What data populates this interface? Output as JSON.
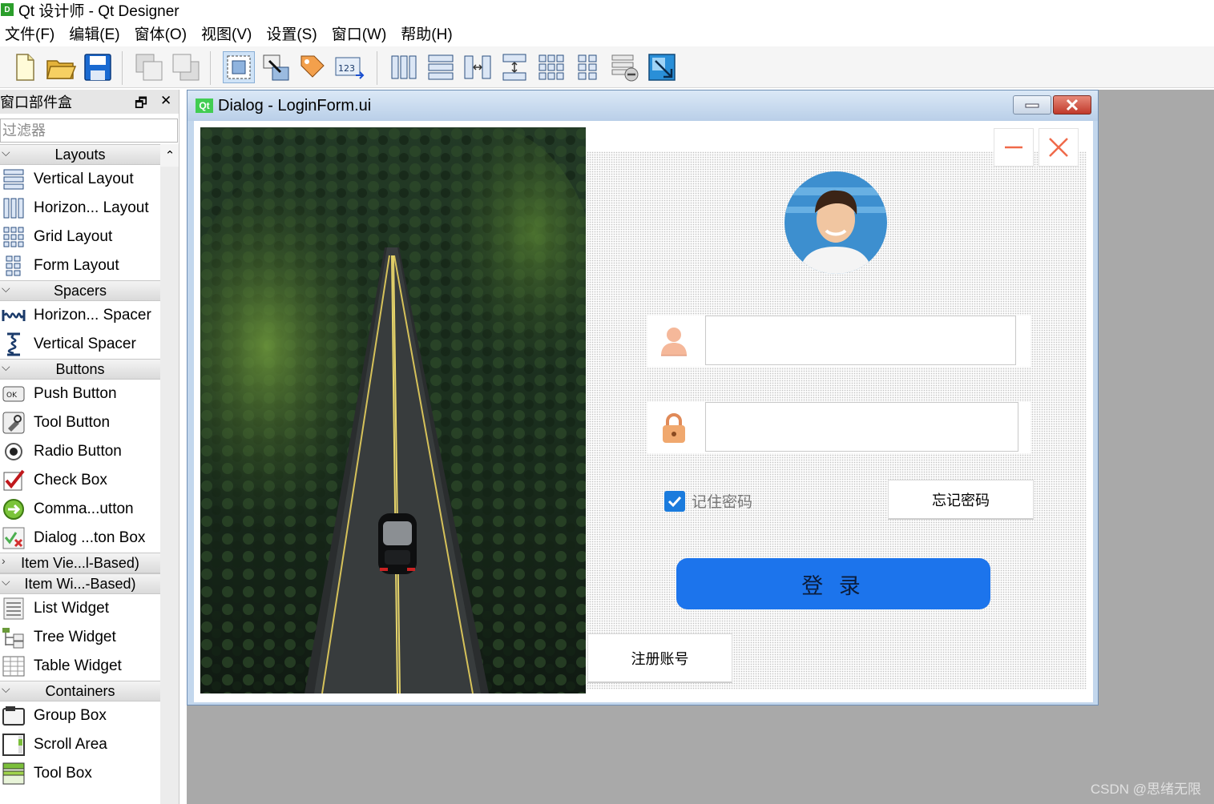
{
  "app": {
    "title": "Qt 设计师 - Qt Designer",
    "icon_letter": "D"
  },
  "menu": [
    "文件(F)",
    "编辑(E)",
    "窗体(O)",
    "视图(V)",
    "设置(S)",
    "窗口(W)",
    "帮助(H)"
  ],
  "toolbar": {
    "icons": [
      "new-file-icon",
      "open-folder-icon",
      "save-icon",
      "send-to-back-icon",
      "bring-to-front-icon",
      "edit-widgets-icon",
      "edit-signals-slots-icon",
      "edit-buddies-icon",
      "edit-tab-order-icon",
      "layout-horizontal-icon",
      "layout-vertical-icon",
      "layout-horizontal-splitter-icon",
      "layout-vertical-splitter-icon",
      "layout-grid-icon",
      "layout-form-icon",
      "break-layout-icon",
      "adjust-size-icon"
    ]
  },
  "widget_box": {
    "title": "窗口部件盒",
    "filter_placeholder": "过滤器",
    "groups": [
      {
        "name": "Layouts",
        "expanded": true,
        "items": [
          {
            "label": "Vertical Layout",
            "icon": "vertical-layout-icon"
          },
          {
            "label": "Horizon... Layout",
            "icon": "horizontal-layout-icon"
          },
          {
            "label": "Grid Layout",
            "icon": "grid-layout-icon"
          },
          {
            "label": "Form Layout",
            "icon": "form-layout-icon"
          }
        ]
      },
      {
        "name": "Spacers",
        "expanded": true,
        "items": [
          {
            "label": "Horizon... Spacer",
            "icon": "horizontal-spacer-icon"
          },
          {
            "label": "Vertical Spacer",
            "icon": "vertical-spacer-icon"
          }
        ]
      },
      {
        "name": "Buttons",
        "expanded": true,
        "items": [
          {
            "label": "Push Button",
            "icon": "push-button-icon"
          },
          {
            "label": "Tool Button",
            "icon": "tool-button-icon"
          },
          {
            "label": "Radio Button",
            "icon": "radio-button-icon"
          },
          {
            "label": "Check Box",
            "icon": "check-box-icon"
          },
          {
            "label": "Comma...utton",
            "icon": "command-link-button-icon"
          },
          {
            "label": "Dialog ...ton Box",
            "icon": "dialog-button-box-icon"
          }
        ]
      },
      {
        "name": "Item Vie...l-Based)",
        "expanded": false,
        "items": []
      },
      {
        "name": "Item Wi...-Based)",
        "expanded": true,
        "items": [
          {
            "label": "List Widget",
            "icon": "list-widget-icon"
          },
          {
            "label": "Tree Widget",
            "icon": "tree-widget-icon"
          },
          {
            "label": "Table Widget",
            "icon": "table-widget-icon"
          }
        ]
      },
      {
        "name": "Containers",
        "expanded": true,
        "items": [
          {
            "label": "Group Box",
            "icon": "group-box-icon"
          },
          {
            "label": "Scroll Area",
            "icon": "scroll-area-icon"
          },
          {
            "label": "Tool Box",
            "icon": "tool-box-icon"
          }
        ]
      }
    ]
  },
  "form_window": {
    "badge": "Qt",
    "title": "Dialog - LoginForm.ui"
  },
  "login_form": {
    "username_value": "",
    "password_value": "",
    "remember_label": "记住密码",
    "remember_checked": true,
    "forget_label": "忘记密码",
    "login_label": "登 录",
    "register_label": "注册账号",
    "accent_color": "#1c74ec",
    "close_color": "#f06a4a"
  },
  "watermark": "CSDN @思绪无限"
}
